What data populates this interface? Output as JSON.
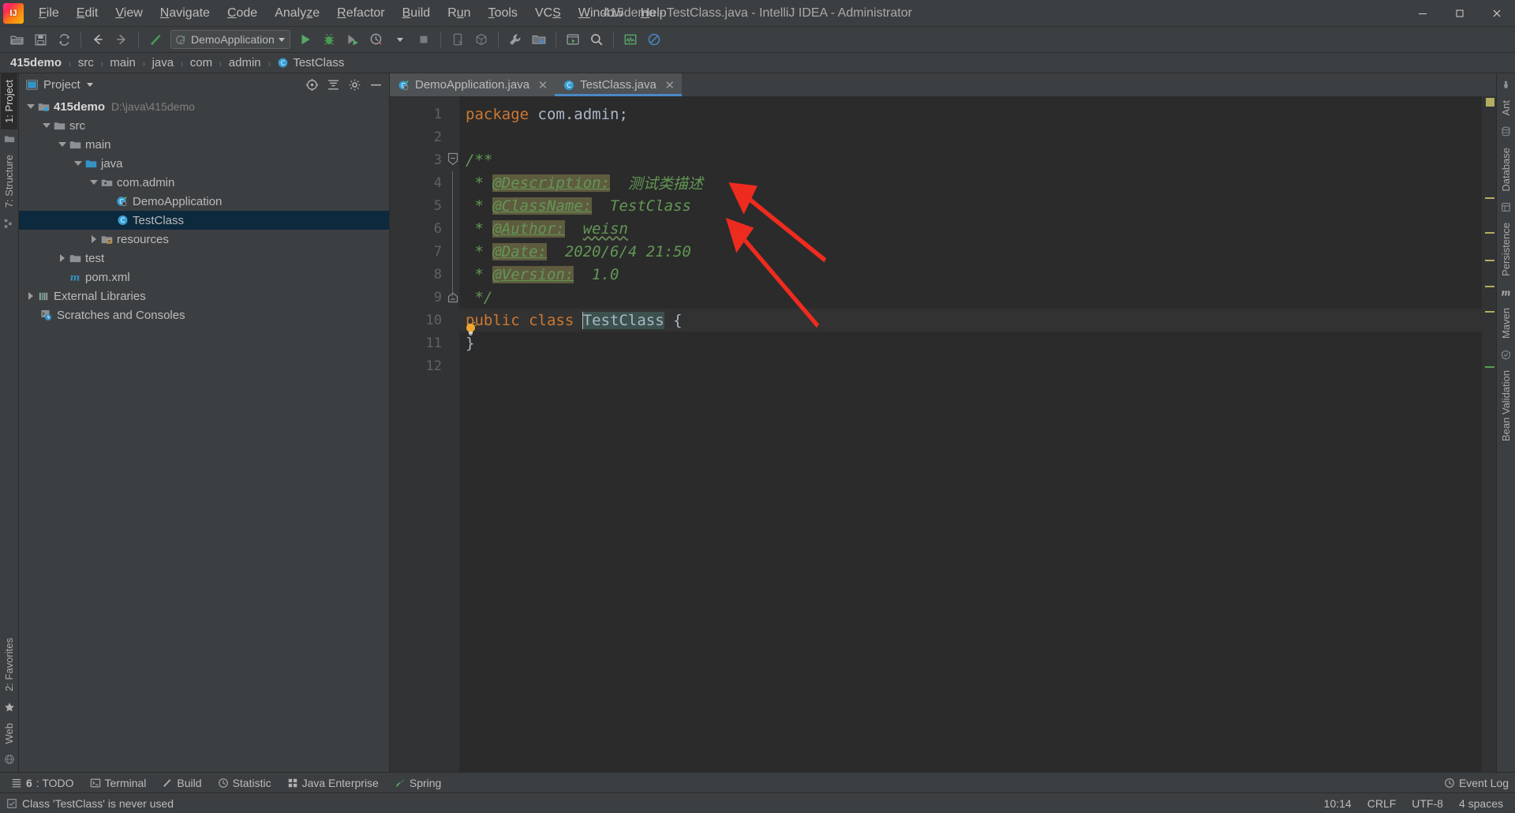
{
  "window": {
    "title": "415demo - TestClass.java - IntelliJ IDEA - Administrator",
    "logo_text": "IJ",
    "minimize_label": "−",
    "maximize_label": "❐",
    "close_label": "✕"
  },
  "menubar": {
    "items": [
      {
        "label": "File",
        "mnemonic": "F"
      },
      {
        "label": "Edit",
        "mnemonic": "E"
      },
      {
        "label": "View",
        "mnemonic": "V"
      },
      {
        "label": "Navigate",
        "mnemonic": "N"
      },
      {
        "label": "Code",
        "mnemonic": "C"
      },
      {
        "label": "Analyze",
        "mnemonic": "z"
      },
      {
        "label": "Refactor",
        "mnemonic": "R"
      },
      {
        "label": "Build",
        "mnemonic": "B"
      },
      {
        "label": "Run",
        "mnemonic": "u"
      },
      {
        "label": "Tools",
        "mnemonic": "T"
      },
      {
        "label": "VCS",
        "mnemonic": "S"
      },
      {
        "label": "Window",
        "mnemonic": "W"
      },
      {
        "label": "Help",
        "mnemonic": "H"
      }
    ]
  },
  "toolbar": {
    "open_icon": "folder-open-icon",
    "save_icon": "save-all-icon",
    "sync_icon": "sync-refresh-icon",
    "back_icon": "navigate-back-icon",
    "forward_icon": "navigate-forward-icon",
    "build_icon": "build-hammer-icon",
    "run_config": {
      "label": "DemoApplication",
      "icon": "spring-boot-run-config-icon",
      "caret": "chevron-down-icon"
    },
    "run_icon": "run-green-arrow-icon",
    "debug_icon": "debug-bug-icon",
    "coverage_icon": "run-with-coverage-icon",
    "profile_icon": "profiler-clock-icon",
    "stop_icon": "stop-square-icon",
    "device_icon": "device-manager-icon",
    "package_icon": "package-cube-icon",
    "settings_icon": "wrench-settings-icon",
    "project-structure_icon": "project-structure-icon",
    "terminal_icon": "run-anything-icon",
    "search_icon": "search-everywhere-icon",
    "memory_icon": "memory-indicator-icon",
    "nomark_icon": "no-entry-circle-icon"
  },
  "breadcrumb": {
    "separator": "›",
    "items": [
      {
        "label": "415demo",
        "bold": true,
        "icon": ""
      },
      {
        "label": "src",
        "bold": false,
        "icon": ""
      },
      {
        "label": "main",
        "bold": false,
        "icon": ""
      },
      {
        "label": "java",
        "bold": false,
        "icon": ""
      },
      {
        "label": "com",
        "bold": false,
        "icon": ""
      },
      {
        "label": "admin",
        "bold": false,
        "icon": ""
      },
      {
        "label": "TestClass",
        "bold": false,
        "icon": "java-class-icon"
      }
    ]
  },
  "left_tool_strip": {
    "tabs": [
      {
        "label": "1: Project",
        "active": true
      },
      {
        "label": "7: Structure",
        "active": false
      },
      {
        "label": "2: Favorites",
        "active": false
      },
      {
        "label": "Web",
        "active": false
      }
    ],
    "icons": [
      "project-folder-icon",
      "structure-icon",
      "favorites-star-icon",
      "web-globe-icon"
    ]
  },
  "right_tool_strip": {
    "tabs": [
      {
        "label": "Ant"
      },
      {
        "label": "Database"
      },
      {
        "label": "Persistence"
      },
      {
        "label": "Maven"
      },
      {
        "label": "Bean Validation"
      }
    ]
  },
  "project_pane": {
    "title": "Project",
    "title_icon": "project-view-icon",
    "caret_icon": "chevron-down-icon",
    "locate_icon": "scroll-from-source-icon",
    "collapse_icon": "collapse-all-icon",
    "settings_icon": "gear-icon",
    "hide_icon": "hide-minus-icon",
    "tree": [
      {
        "label": "415demo",
        "sub": "D:\\java\\415demo",
        "indent": 0,
        "arrow": "down",
        "icon": "module-folder-icon",
        "bold": true,
        "selected": false
      },
      {
        "label": "src",
        "sub": "",
        "indent": 1,
        "arrow": "down",
        "icon": "folder-icon",
        "bold": false,
        "selected": false
      },
      {
        "label": "main",
        "sub": "",
        "indent": 2,
        "arrow": "down",
        "icon": "folder-icon",
        "bold": false,
        "selected": false
      },
      {
        "label": "java",
        "sub": "",
        "indent": 3,
        "arrow": "down",
        "icon": "source-root-folder-icon",
        "bold": false,
        "selected": false
      },
      {
        "label": "com.admin",
        "sub": "",
        "indent": 4,
        "arrow": "down",
        "icon": "package-folder-icon",
        "bold": false,
        "selected": false
      },
      {
        "label": "DemoApplication",
        "sub": "",
        "indent": 5,
        "arrow": "none",
        "icon": "java-class-run-icon",
        "bold": false,
        "selected": false
      },
      {
        "label": "TestClass",
        "sub": "",
        "indent": 5,
        "arrow": "none",
        "icon": "java-class-icon",
        "bold": false,
        "selected": true
      },
      {
        "label": "resources",
        "sub": "",
        "indent": 3,
        "arrow": "right",
        "icon": "resources-folder-icon",
        "bold": false,
        "selected": false
      },
      {
        "label": "test",
        "sub": "",
        "indent": 2,
        "arrow": "right",
        "icon": "folder-icon",
        "bold": false,
        "selected": false
      },
      {
        "label": "pom.xml",
        "sub": "",
        "indent": 2,
        "arrow": "none",
        "icon": "maven-m-icon",
        "bold": false,
        "selected": false
      },
      {
        "label": "External Libraries",
        "sub": "",
        "indent": 0,
        "arrow": "right",
        "icon": "libraries-icon",
        "bold": false,
        "selected": false
      },
      {
        "label": "Scratches and Consoles",
        "sub": "",
        "indent": 0,
        "arrow": "none",
        "icon": "scratches-icon",
        "bold": false,
        "selected": false
      }
    ]
  },
  "editor": {
    "tabs": [
      {
        "label": "DemoApplication.java",
        "icon": "java-class-run-icon",
        "active": false,
        "close": "✕"
      },
      {
        "label": "TestClass.java",
        "icon": "java-class-icon",
        "active": true,
        "close": "✕"
      }
    ],
    "line_numbers": [
      "1",
      "2",
      "3",
      "4",
      "5",
      "6",
      "7",
      "8",
      "9",
      "10",
      "11",
      "12"
    ],
    "code_lines": [
      {
        "n": 1,
        "segments": [
          {
            "t": "package ",
            "c": "kw"
          },
          {
            "t": "com.admin;",
            "c": "ident"
          }
        ]
      },
      {
        "n": 2,
        "segments": []
      },
      {
        "n": 3,
        "segments": [
          {
            "t": "/**",
            "c": "cmt"
          }
        ]
      },
      {
        "n": 4,
        "segments": [
          {
            "t": " * ",
            "c": "cmt"
          },
          {
            "t": "@Description:",
            "c": "cmt-tag"
          },
          {
            "t": "  测试类描述",
            "c": "cmt-val"
          }
        ]
      },
      {
        "n": 5,
        "segments": [
          {
            "t": " * ",
            "c": "cmt"
          },
          {
            "t": "@ClassName:",
            "c": "cmt-tag"
          },
          {
            "t": "  TestClass",
            "c": "cmt-val"
          }
        ]
      },
      {
        "n": 6,
        "segments": [
          {
            "t": " * ",
            "c": "cmt"
          },
          {
            "t": "@Author:",
            "c": "cmt-tag"
          },
          {
            "t": "  ",
            "c": "cmt-val"
          },
          {
            "t": "weisn",
            "c": "cmt-val spell"
          }
        ]
      },
      {
        "n": 7,
        "segments": [
          {
            "t": " * ",
            "c": "cmt"
          },
          {
            "t": "@Date:",
            "c": "cmt-tag"
          },
          {
            "t": "  2020/6/4 21:50",
            "c": "cmt-val"
          }
        ]
      },
      {
        "n": 8,
        "segments": [
          {
            "t": " * ",
            "c": "cmt"
          },
          {
            "t": "@Version:",
            "c": "cmt-tag"
          },
          {
            "t": "  1.0",
            "c": "cmt-val"
          }
        ]
      },
      {
        "n": 9,
        "segments": [
          {
            "t": " */",
            "c": "cmt"
          }
        ]
      },
      {
        "n": 10,
        "segments": [
          {
            "t": "public class ",
            "c": "kw"
          },
          {
            "t": "TestClass",
            "c": "ident-hl"
          },
          {
            "t": " {",
            "c": "ident"
          }
        ]
      },
      {
        "n": 11,
        "segments": [
          {
            "t": "}",
            "c": "ident"
          }
        ]
      },
      {
        "n": 12,
        "segments": []
      }
    ],
    "fold_line_3": "fold-collapse-icon",
    "fold_line_9": "fold-end-icon",
    "intention_bulb": "intention-bulb-icon",
    "gutter_javadoc_icon": "javadoc-rendering-icon",
    "caret_line": 10
  },
  "annotations": {
    "arrow_1": "red-arrow-pointer",
    "arrow_2": "red-arrow-pointer",
    "color": "#ee2b1f"
  },
  "bottom_toolbar": {
    "items": [
      {
        "num": "6",
        "label": ": TODO",
        "icon": "todo-list-icon"
      },
      {
        "num": "",
        "label": "Terminal",
        "icon": "terminal-icon"
      },
      {
        "num": "",
        "label": "Build",
        "icon": "build-hammer-icon"
      },
      {
        "num": "",
        "label": "Statistic",
        "icon": "statistic-clock-icon"
      },
      {
        "num": "",
        "label": "Java Enterprise",
        "icon": "java-enterprise-icon"
      },
      {
        "num": "",
        "label": "Spring",
        "icon": "spring-leaf-icon"
      }
    ],
    "event_log": {
      "label": "Event Log",
      "icon": "event-log-icon"
    }
  },
  "statusbar": {
    "message": "Class 'TestClass' is never used",
    "message_icon": "inspection-info-icon",
    "position": "10:14",
    "line_separator": "CRLF",
    "encoding": "UTF-8",
    "indent": "4 spaces"
  },
  "colors": {
    "chrome_bg": "#3c3f41",
    "editor_bg": "#2b2b2b",
    "gutter_bg": "#313335",
    "selection_bg": "#0d293e",
    "tab_active_underline": "#4a88c7",
    "comment_green": "#629755",
    "keyword_orange": "#cc7832",
    "javadoc_tag_bg": "#5f5b3f",
    "annotation_red": "#ee2b1f"
  }
}
